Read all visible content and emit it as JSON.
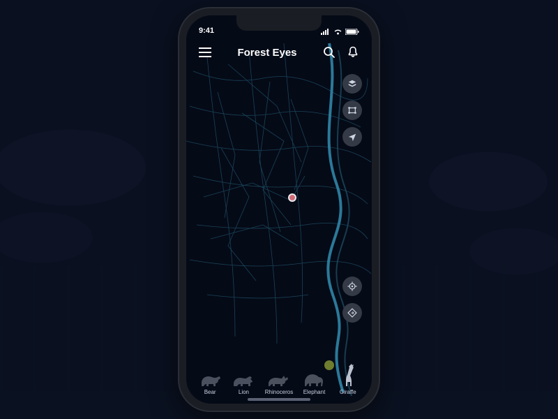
{
  "statusbar": {
    "time": "9:41"
  },
  "header": {
    "title": "Forest Eyes"
  },
  "map_tools": {
    "top": [
      {
        "name": "layers-icon"
      },
      {
        "name": "bounds-icon"
      },
      {
        "name": "navigate-arrow-icon"
      }
    ],
    "bottom": [
      {
        "name": "target-crosshair-icon"
      },
      {
        "name": "directions-icon"
      }
    ]
  },
  "animals": [
    {
      "id": "bear",
      "label": "Bear"
    },
    {
      "id": "lion",
      "label": "Lion"
    },
    {
      "id": "rhinoceros",
      "label": "Rhinoceros"
    },
    {
      "id": "elephant",
      "label": "Elephant"
    },
    {
      "id": "giraffe",
      "label": "Giraffe",
      "active": true
    }
  ],
  "colors": {
    "map_line": "#1b4a5f",
    "map_line_bright": "#2d7fa0",
    "marker_fill": "#d16a76",
    "active_dot": "#6f7d2f"
  }
}
